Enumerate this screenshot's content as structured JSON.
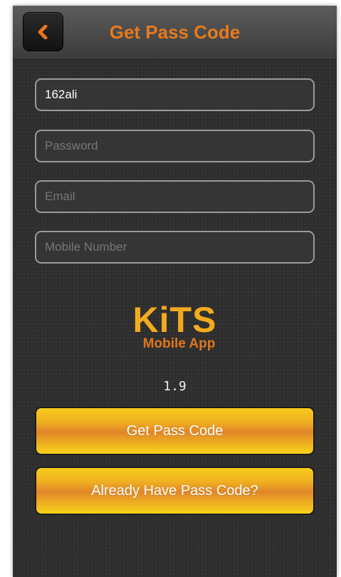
{
  "header": {
    "title": "Get Pass Code",
    "back_icon": "chevron-left-icon",
    "accent_color": "#e67a1e"
  },
  "form": {
    "username": {
      "value": "162ali",
      "placeholder": ""
    },
    "password": {
      "value": "",
      "placeholder": "Password"
    },
    "email": {
      "value": "",
      "placeholder": "Email"
    },
    "mobile": {
      "value": "",
      "placeholder": "Mobile Number"
    }
  },
  "logo": {
    "main": "KiTS",
    "sub": "Mobile App"
  },
  "version": "1.9",
  "buttons": {
    "get_pass_code": "Get Pass Code",
    "already_have": "Already Have Pass Code?"
  },
  "colors": {
    "button_gold": "#f6cc1b",
    "button_orange": "#e08629",
    "logo_gold": "#f2aa1f",
    "logo_orange": "#e0761c"
  }
}
